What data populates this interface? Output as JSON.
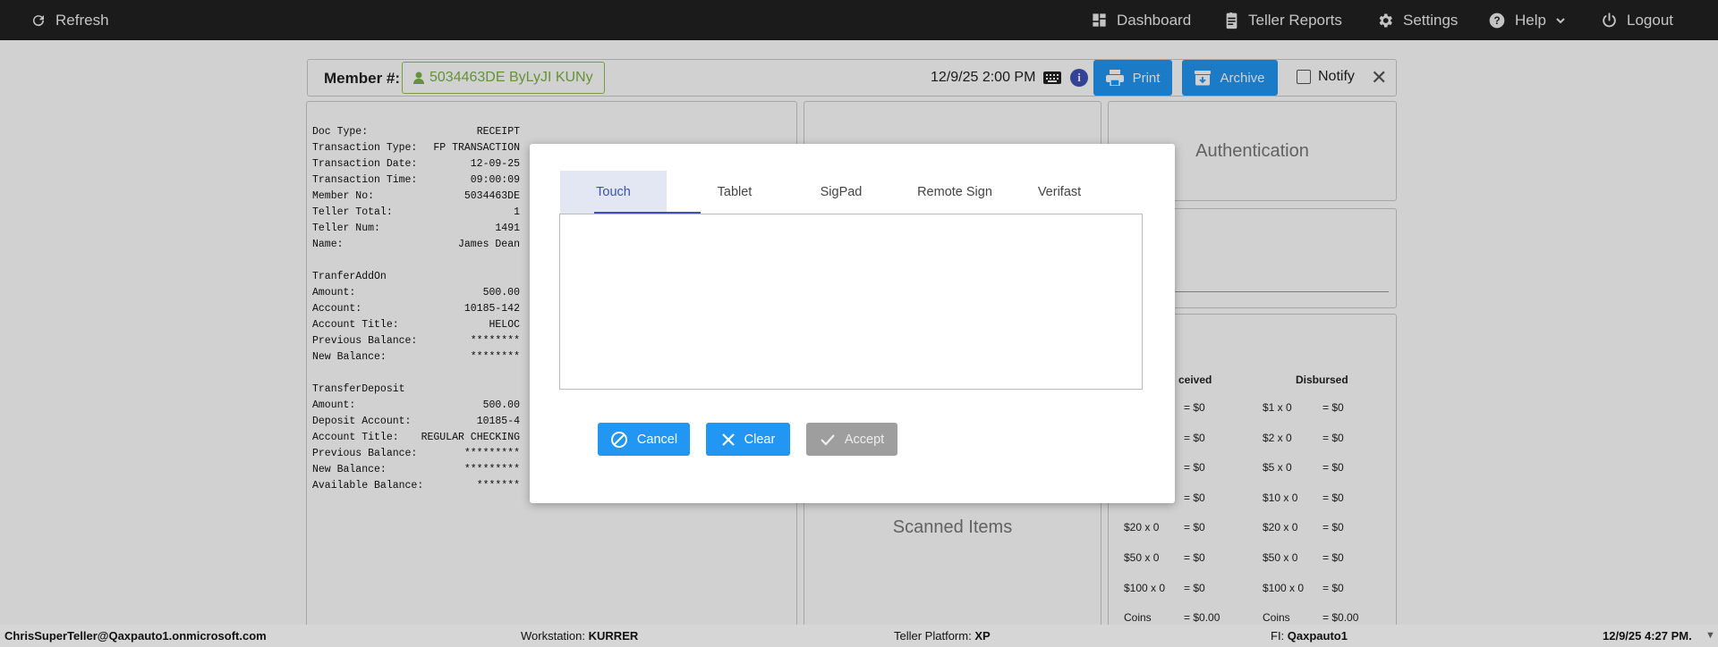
{
  "topbar": {
    "refresh": "Refresh",
    "dashboard": "Dashboard",
    "teller_reports": "Teller Reports",
    "settings": "Settings",
    "help": "Help",
    "logout": "Logout"
  },
  "member_bar": {
    "label": "Member #:",
    "member": "5034463DE ByLyJI KUNy",
    "datetime": "12/9/25 2:00 PM",
    "info": "i",
    "print": "Print",
    "archive": "Archive",
    "notify": "Notify",
    "close": "✕"
  },
  "receipt": {
    "rows": [
      {
        "label": "Doc Type:",
        "value": "RECEIPT"
      },
      {
        "label": "Transaction Type:",
        "value": "FP TRANSACTION"
      },
      {
        "label": "Transaction Date:",
        "value": "12-09-25"
      },
      {
        "label": "Transaction Time:",
        "value": "09:00:09"
      },
      {
        "label": "Member No:",
        "value": "5034463DE"
      },
      {
        "label": "Teller Total:",
        "value": "1"
      },
      {
        "label": "Teller Num:",
        "value": "1491"
      },
      {
        "label": "Name:",
        "value": "James Dean"
      },
      {
        "label": "",
        "value": ""
      },
      {
        "label": "TranferAddOn",
        "value": ""
      },
      {
        "label": "Amount:",
        "value": "500.00"
      },
      {
        "label": "Account:",
        "value": "10185-142"
      },
      {
        "label": "Account Title:",
        "value": "HELOC"
      },
      {
        "label": "Previous Balance:",
        "value": "********"
      },
      {
        "label": "New Balance:",
        "value": "********"
      },
      {
        "label": "",
        "value": ""
      },
      {
        "label": "TransferDeposit",
        "value": ""
      },
      {
        "label": "Amount:",
        "value": "500.00"
      },
      {
        "label": "Deposit Account:",
        "value": "10185-4"
      },
      {
        "label": "Account Title:",
        "value": "REGULAR CHECKING"
      },
      {
        "label": "Previous Balance:",
        "value": "*********"
      },
      {
        "label": "New Balance:",
        "value": "*********"
      },
      {
        "label": "Available Balance:",
        "value": "*******"
      }
    ]
  },
  "panels": {
    "authentication": "Authentication",
    "scanned_items": "Scanned Items"
  },
  "cash": {
    "received_header": "ceived",
    "disbursed_header": "Disbursed",
    "received_rows": [
      {
        "denom": "",
        "total": "= $0"
      },
      {
        "denom": "",
        "total": "= $0"
      },
      {
        "denom": "",
        "total": "= $0"
      },
      {
        "denom": "",
        "total": "= $0"
      },
      {
        "denom": "$20 x 0",
        "total": "= $0"
      },
      {
        "denom": "$50 x 0",
        "total": "= $0"
      },
      {
        "denom": "$100 x 0",
        "total": "= $0"
      },
      {
        "denom": "Coins",
        "total": "= $0.00"
      }
    ],
    "disbursed_rows": [
      {
        "denom": "$1 x 0",
        "total": "= $0"
      },
      {
        "denom": "$2 x 0",
        "total": "= $0"
      },
      {
        "denom": "$5 x 0",
        "total": "= $0"
      },
      {
        "denom": "$10 x 0",
        "total": "= $0"
      },
      {
        "denom": "$20 x 0",
        "total": "= $0"
      },
      {
        "denom": "$50 x 0",
        "total": "= $0"
      },
      {
        "denom": "$100 x 0",
        "total": "= $0"
      },
      {
        "denom": "Coins",
        "total": "= $0.00"
      }
    ]
  },
  "modal": {
    "tabs": [
      "Touch",
      "Tablet",
      "SigPad",
      "Remote Sign",
      "Verifast"
    ],
    "active_tab": "Touch",
    "cancel": "Cancel",
    "clear": "Clear",
    "accept": "Accept"
  },
  "statusbar": {
    "user": "ChrisSuperTeller@Qaxpauto1.onmicrosoft.com",
    "workstation_label": "Workstation:",
    "workstation": "KURRER",
    "platform_label": "Teller Platform:",
    "platform": "XP",
    "fi_label": "FI:",
    "fi": "Qaxpauto1",
    "datetime": "12/9/25 4:27 PM."
  },
  "colors": {
    "topbar": "#222222",
    "primary": "#2196f3",
    "member_green": "#7cb342",
    "tab_accent": "#3f51b5",
    "accept_disabled": "#9e9e9e"
  }
}
